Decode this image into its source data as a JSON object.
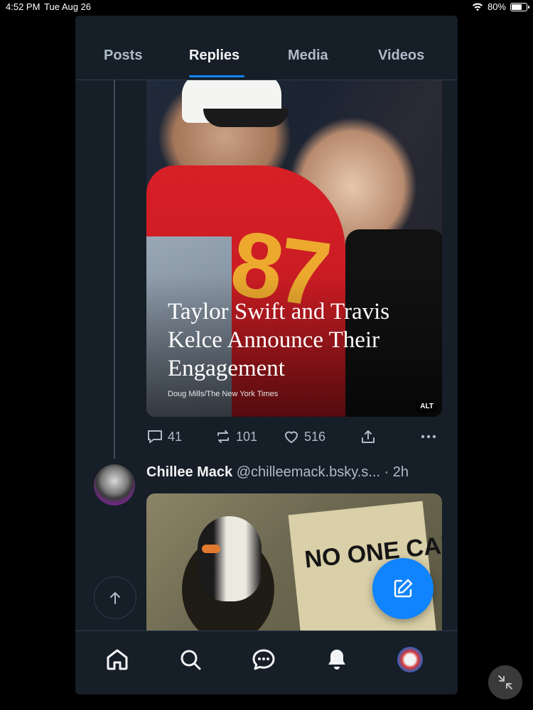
{
  "status_bar": {
    "time": "4:52 PM",
    "date": "Tue Aug 26",
    "battery": "80%",
    "battery_level": 0.8
  },
  "tabs": [
    {
      "label": "Posts",
      "active": false
    },
    {
      "label": "Replies",
      "active": true
    },
    {
      "label": "Media",
      "active": false
    },
    {
      "label": "Videos",
      "active": false
    }
  ],
  "embed": {
    "headline": "Taylor Swift and Travis Kelce Announce Their Engagement",
    "credit": "Doug Mills/The New York Times",
    "alt_badge": "ALT"
  },
  "post_actions": {
    "replies": "41",
    "reposts": "101",
    "likes": "516"
  },
  "post2": {
    "name": "Chillee Mack",
    "handle": "@chilleemack.bsky.s...",
    "time": "· 2h",
    "gif_text": "NO ONE CARES"
  },
  "colors": {
    "accent": "#1083fe",
    "background": "#161e27",
    "muted": "#aebbc9"
  },
  "icons": [
    "home-icon",
    "search-icon",
    "chat-icon",
    "bell-icon",
    "profile-avatar",
    "compose-icon",
    "arrow-up-icon",
    "collapse-icon"
  ]
}
